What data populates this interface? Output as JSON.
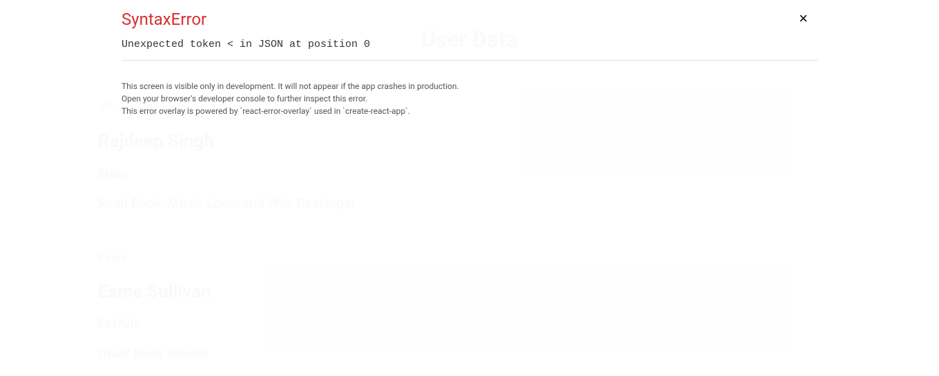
{
  "page": {
    "title": "User Data"
  },
  "users": [
    {
      "email": "officialrajdeepsingh",
      "name": "Rajdeep Singh",
      "gender": "Male",
      "bio": "Read Book, Music Lover and Web Developer"
    },
    {
      "nickname": "Esme",
      "name": "Esme Sullivan",
      "gender": "FeMale",
      "bio": "Graet Book Reader"
    }
  ],
  "error": {
    "title": "SyntaxError",
    "message": "Unexpected token < in JSON at position 0",
    "help_line1": "This screen is visible only in development. It will not appear if the app crashes in production.",
    "help_line2": "Open your browser's developer console to further inspect this error.",
    "help_line3": "This error overlay is powered by `react-error-overlay` used in `create-react-app`.",
    "close_label": "×"
  }
}
